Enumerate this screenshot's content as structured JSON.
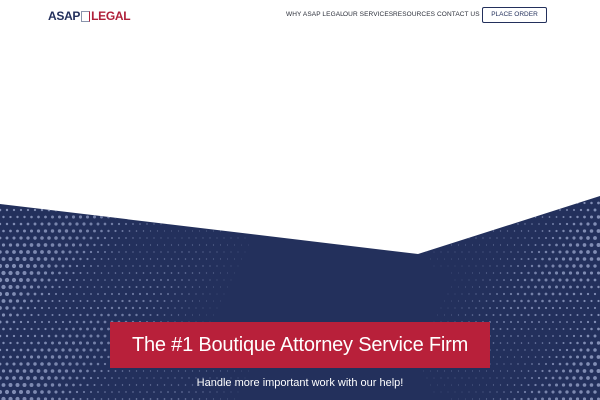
{
  "brand": {
    "logo_left": "ASAP",
    "logo_right": "LEGAL",
    "colors": {
      "navy": "#23305c",
      "red": "#b8203a",
      "dots": "#8e9ac0"
    }
  },
  "nav": {
    "items": [
      {
        "label": "WHY ASAP LEGAL"
      },
      {
        "label": "OUR SERVICES"
      },
      {
        "label": "RESOURCES"
      },
      {
        "label": "CONTACT US"
      }
    ],
    "cta_label": "PLACE ORDER"
  },
  "hero": {
    "headline": "The #1 Boutique Attorney Service Firm",
    "subheadline": "Handle more important work with our help!"
  }
}
